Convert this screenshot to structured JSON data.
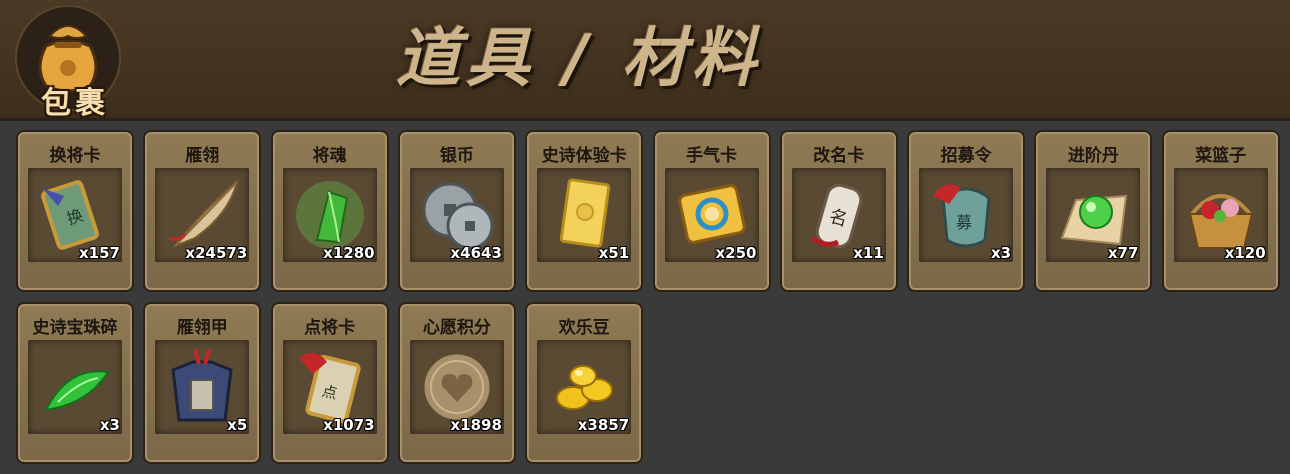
{
  "header": {
    "bag_label": "包裹",
    "title": "道具 / 材料"
  },
  "items": [
    {
      "name": "换将卡",
      "count": "x157",
      "icon": "swap-general-card-icon"
    },
    {
      "name": "雁翎",
      "count": "x24573",
      "icon": "feather-icon"
    },
    {
      "name": "将魂",
      "count": "x1280",
      "icon": "green-crystal-icon"
    },
    {
      "name": "银币",
      "count": "x4643",
      "icon": "silver-coin-icon"
    },
    {
      "name": "史诗体验卡",
      "count": "x51",
      "icon": "gold-card-icon"
    },
    {
      "name": "手气卡",
      "count": "x250",
      "icon": "luck-card-icon"
    },
    {
      "name": "改名卡",
      "count": "x11",
      "icon": "rename-card-icon"
    },
    {
      "name": "招募令",
      "count": "x3",
      "icon": "recruit-token-icon"
    },
    {
      "name": "进阶丹",
      "count": "x77",
      "icon": "green-pill-icon"
    },
    {
      "name": "菜篮子",
      "count": "x120",
      "icon": "flower-basket-icon"
    },
    {
      "name": "史诗宝珠碎",
      "count": "x3",
      "icon": "green-shard-icon"
    },
    {
      "name": "雁翎甲",
      "count": "x5",
      "icon": "armor-icon"
    },
    {
      "name": "点将卡",
      "count": "x1073",
      "icon": "select-general-card-icon"
    },
    {
      "name": "心愿积分",
      "count": "x1898",
      "icon": "heart-coin-icon"
    },
    {
      "name": "欢乐豆",
      "count": "x3857",
      "icon": "gold-beans-icon"
    }
  ]
}
